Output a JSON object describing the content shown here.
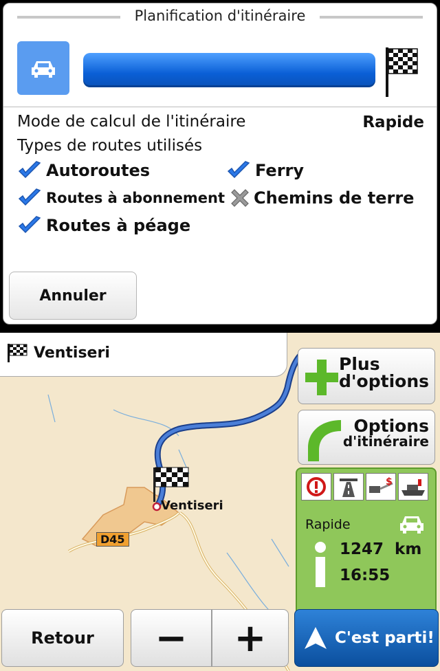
{
  "dialog": {
    "title": "Planification d'itinéraire",
    "mode_label": "Mode de calcul de l'itinéraire",
    "mode_value": "Rapide",
    "types_label": "Types de routes utilisés",
    "road_types": [
      {
        "label": "Autoroutes",
        "enabled": true
      },
      {
        "label": "Ferry",
        "enabled": true
      },
      {
        "label": "Routes à abonnement",
        "enabled": true
      },
      {
        "label": "Chemins de terre",
        "enabled": false
      },
      {
        "label": "Routes à péage",
        "enabled": true
      }
    ],
    "cancel_label": "Annuler",
    "progress": 1.0
  },
  "map": {
    "destination": "Ventiseri",
    "place_label": "Ventiseri",
    "road_label": "D45",
    "more_options_line1": "Plus",
    "more_options_line2": "d'options",
    "route_options_line1": "Options",
    "route_options_line2": "d'itinéraire",
    "route_mode": "Rapide",
    "distance_value": "1247",
    "distance_unit": "km",
    "eta": "16:55",
    "back_label": "Retour",
    "zoom_out_label": "−",
    "zoom_in_label": "+",
    "go_label": "C'est parti!"
  },
  "colors": {
    "accent_blue": "#0a5fd6",
    "route_blue": "#3a6fc8",
    "panel_green": "#8fc75a",
    "check_blue": "#2b78e8",
    "map_bg": "#f4e7cc"
  }
}
